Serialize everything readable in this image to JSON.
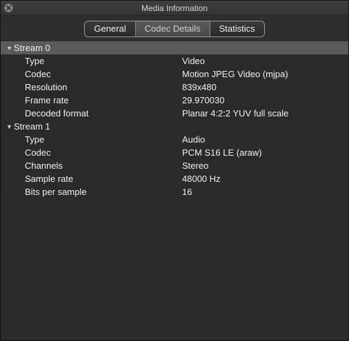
{
  "window": {
    "title": "Media Information"
  },
  "tabs": [
    {
      "label": "General"
    },
    {
      "label": "Codec Details"
    },
    {
      "label": "Statistics"
    }
  ],
  "streams": [
    {
      "label": "Stream 0",
      "rows": [
        {
          "key": "Type",
          "value": "Video"
        },
        {
          "key": "Codec",
          "value": "Motion JPEG Video (mjpa)"
        },
        {
          "key": "Resolution",
          "value": "839x480"
        },
        {
          "key": "Frame rate",
          "value": "29.970030"
        },
        {
          "key": "Decoded format",
          "value": "Planar 4:2:2 YUV full scale"
        }
      ]
    },
    {
      "label": "Stream 1",
      "rows": [
        {
          "key": "Type",
          "value": "Audio"
        },
        {
          "key": "Codec",
          "value": "PCM S16 LE (araw)"
        },
        {
          "key": "Channels",
          "value": "Stereo"
        },
        {
          "key": "Sample rate",
          "value": "48000 Hz"
        },
        {
          "key": "Bits per sample",
          "value": "16"
        }
      ]
    }
  ]
}
